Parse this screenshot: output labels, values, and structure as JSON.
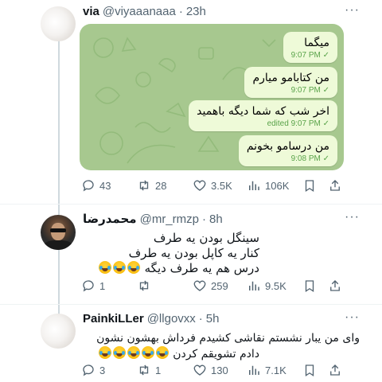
{
  "tweets": [
    {
      "name": "via",
      "handle": "@viyaaanaaa",
      "time": "23h",
      "more": "···",
      "chat": {
        "colors": {
          "bg": "#a7c88f",
          "bubble": "#eefad8",
          "tick": "#5aa34a"
        },
        "messages": [
          {
            "text": "میگما",
            "meta": "9:07 PM ✓"
          },
          {
            "text": "من کتابامو میارم",
            "meta": "9:07 PM ✓"
          },
          {
            "text": "اخر شب که شما دیگه باهمید",
            "meta": "edited 9:07 PM ✓"
          },
          {
            "text": "من درسامو بخونم",
            "meta": "9:08 PM ✓"
          }
        ]
      },
      "stats": {
        "replies": "43",
        "retweets": "28",
        "likes": "3.5K",
        "views": "106K"
      }
    },
    {
      "name": "محمدرضا",
      "handle": "@mr_rmzp",
      "time": "8h",
      "more": "···",
      "lines": [
        "سینگل بودن یه طرف",
        "کنار یه کاپل بودن یه طرف",
        "درس هم یه طرف دیگه"
      ],
      "stats": {
        "replies": "1",
        "retweets": "",
        "likes": "259",
        "views": "9.5K"
      }
    },
    {
      "name": "PainkiLLer",
      "handle": "@llgovxx",
      "time": "5h",
      "more": "···",
      "lines": [
        "وای من یبار نشستم نقاشی کشیدم فرداش بهشون نشون",
        "دادم تشویقم کردن"
      ],
      "stats": {
        "replies": "3",
        "retweets": "1",
        "likes": "130",
        "views": "7.1K"
      }
    }
  ],
  "colors": {
    "muted": "#536471",
    "text": "#0f1419",
    "line": "#cfd9de"
  },
  "icons": [
    "reply-icon",
    "retweet-icon",
    "like-icon",
    "views-icon",
    "bookmark-icon",
    "share-icon"
  ]
}
